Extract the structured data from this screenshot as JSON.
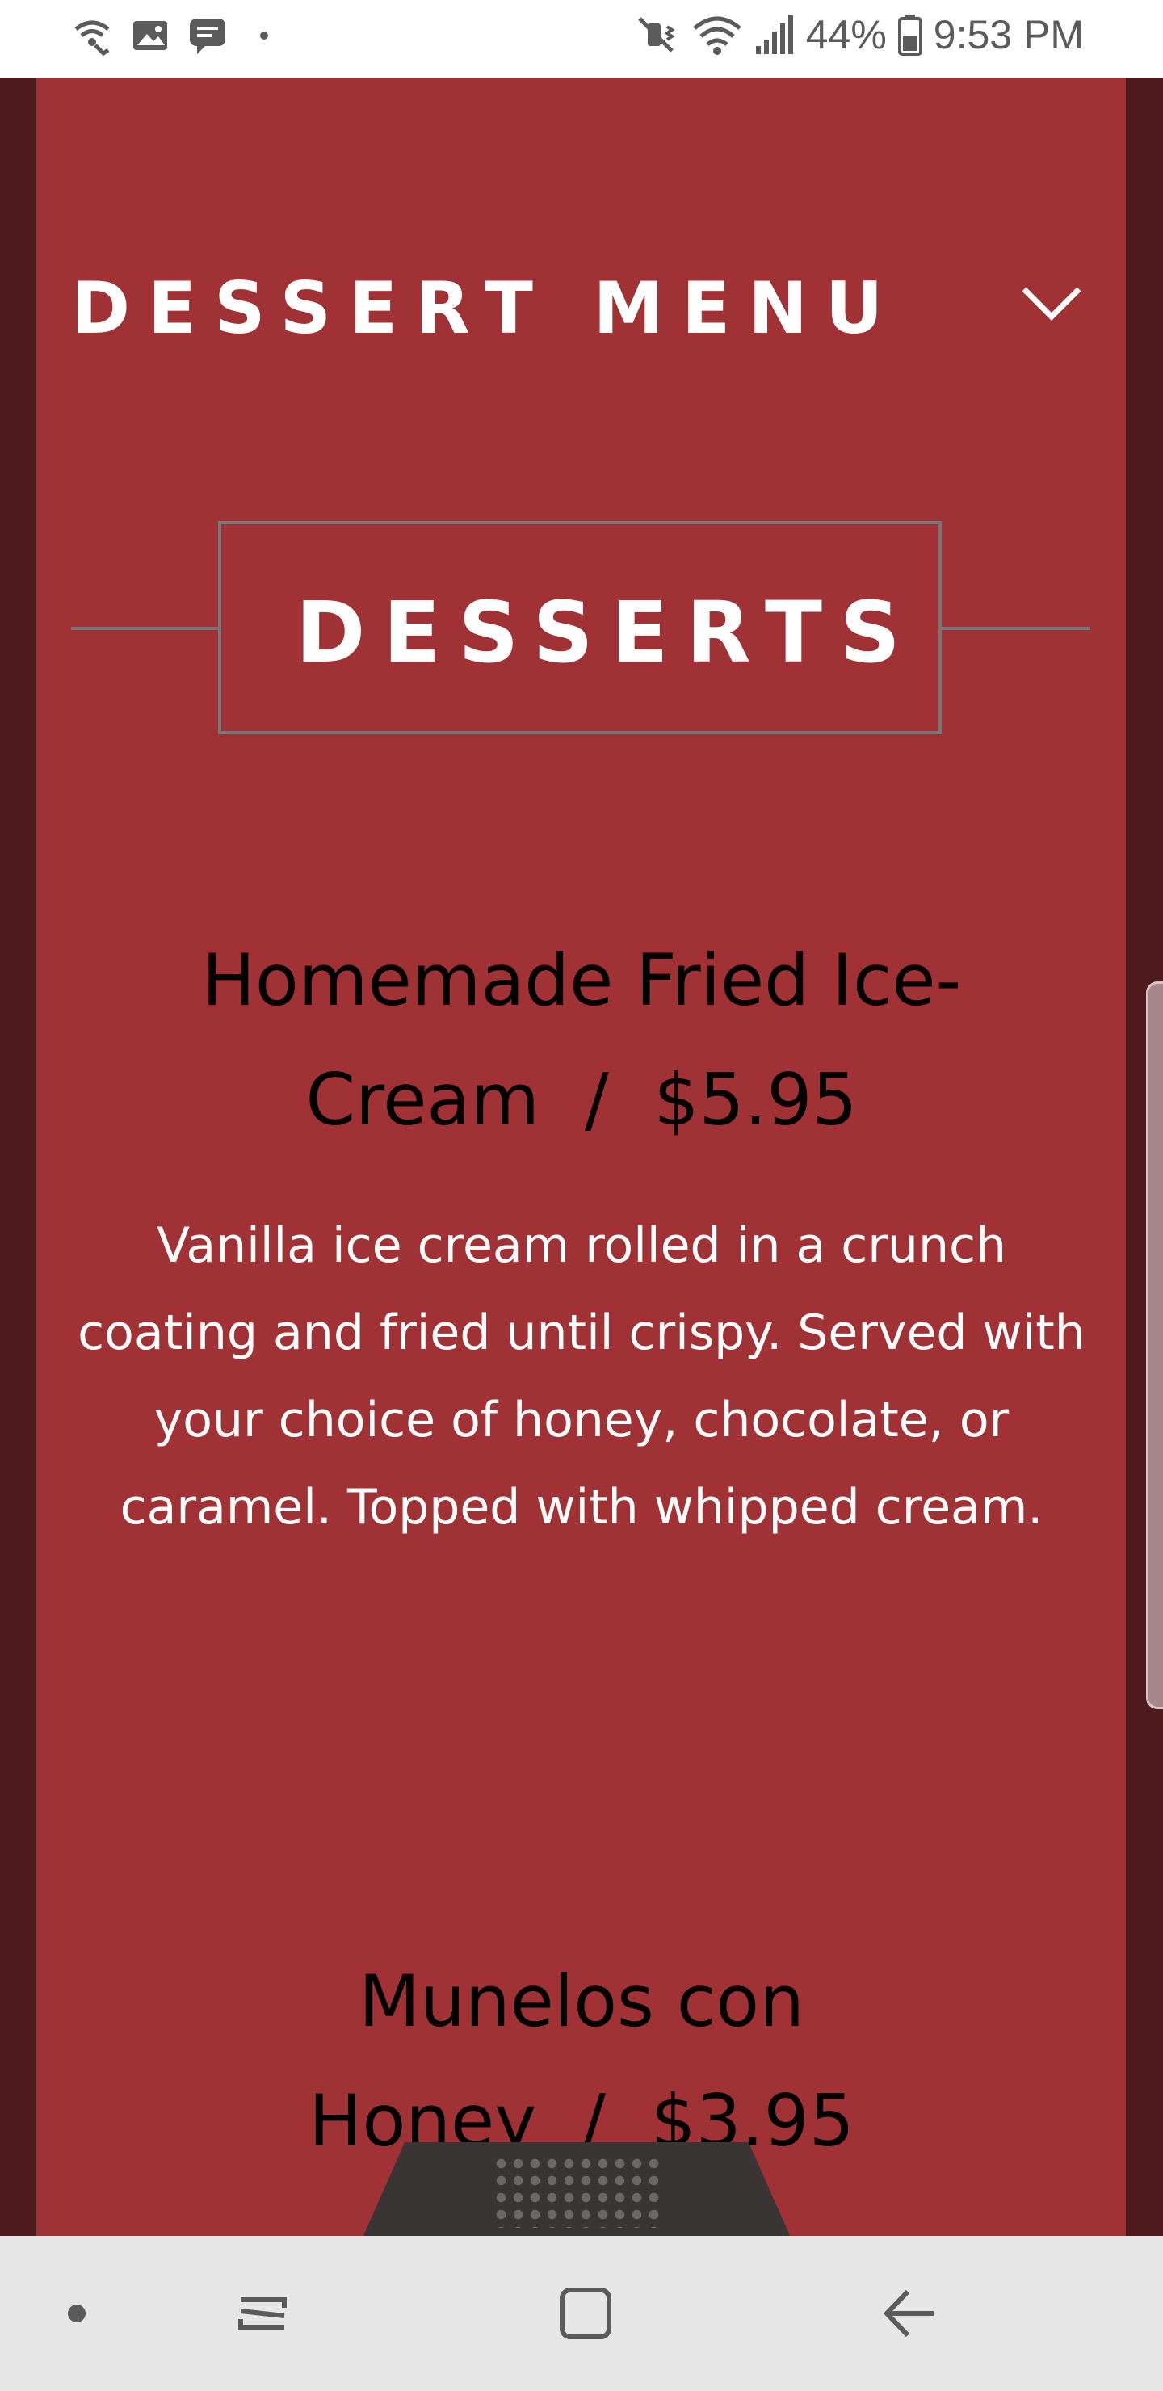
{
  "status_bar": {
    "left_icons": [
      "wifi-call-icon",
      "image-icon",
      "message-icon"
    ],
    "right_icons": [
      "mute-icon",
      "wifi-icon",
      "signal-icon",
      "battery-icon"
    ],
    "battery": "44%",
    "time": "9:53 PM"
  },
  "menu": {
    "section_title": "DESSERT MENU",
    "category_title": "DESSERTS",
    "items": [
      {
        "title_line1": "Homemade Fried Ice-",
        "title_line2": "Cream  /  $5.95",
        "description": "Vanilla ice cream rolled in a crunch coating and fried until crispy. Served with your choice of honey, chocolate, or caramel. Topped with whipped cream."
      },
      {
        "title_line1": "Munelos con",
        "title_line2": "Honey  /  $3.95"
      }
    ]
  },
  "nav_bar": {
    "buttons": [
      "dot-icon",
      "recents-icon",
      "home-icon",
      "back-icon"
    ]
  },
  "colors": {
    "page_red": "#a03134",
    "side_dark": "#4e1a1d",
    "status_bar_bg": "#ffffff",
    "nav_bar_bg": "#e6e6e6"
  }
}
